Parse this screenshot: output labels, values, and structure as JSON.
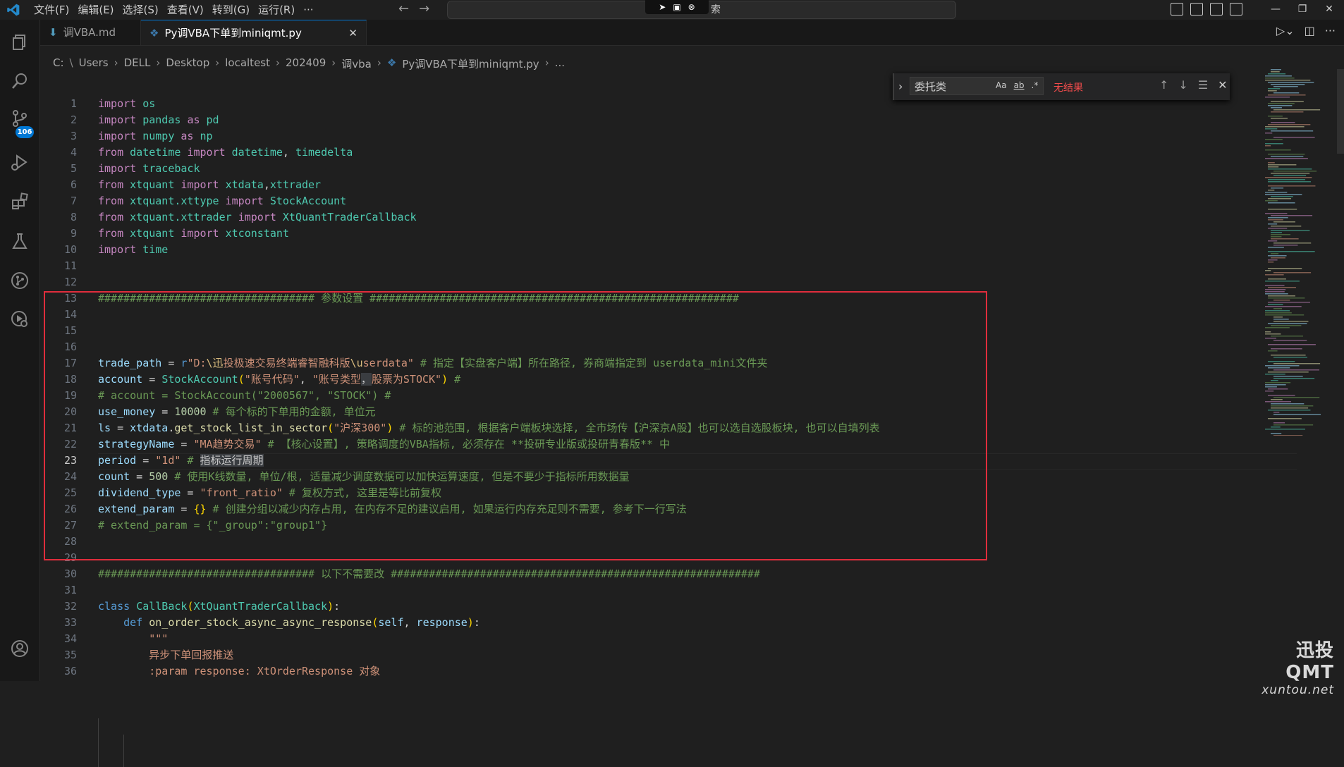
{
  "menu": [
    "文件(F)",
    "编辑(E)",
    "选择(S)",
    "查看(V)",
    "转到(G)",
    "运行(R)",
    "···"
  ],
  "command_center": {
    "text": "索"
  },
  "source_control_badge": "106",
  "tabs": [
    {
      "label": "调VBA.md",
      "icon": "markdown-icon",
      "active": false
    },
    {
      "label": "Py调VBA下单到miniqmt.py",
      "icon": "python-icon",
      "active": true
    }
  ],
  "breadcrumb": [
    "C:",
    "Users",
    "DELL",
    "Desktop",
    "localtest",
    "202409",
    "调vba",
    "Py调VBA下单到miniqmt.py",
    "..."
  ],
  "find": {
    "value": "委托类",
    "options": [
      "Aa",
      "ab",
      ".*"
    ],
    "result": "无结果"
  },
  "current_line": 23,
  "code": [
    [
      [
        "kw",
        "import"
      ],
      [
        "txt",
        " "
      ],
      [
        "cls",
        "os"
      ]
    ],
    [
      [
        "kw",
        "import"
      ],
      [
        "txt",
        " "
      ],
      [
        "cls",
        "pandas"
      ],
      [
        "txt",
        " "
      ],
      [
        "kw",
        "as"
      ],
      [
        "txt",
        " "
      ],
      [
        "cls",
        "pd"
      ]
    ],
    [
      [
        "kw",
        "import"
      ],
      [
        "txt",
        " "
      ],
      [
        "cls",
        "numpy"
      ],
      [
        "txt",
        " "
      ],
      [
        "kw",
        "as"
      ],
      [
        "txt",
        " "
      ],
      [
        "cls",
        "np"
      ]
    ],
    [
      [
        "kw",
        "from"
      ],
      [
        "txt",
        " "
      ],
      [
        "cls",
        "datetime"
      ],
      [
        "txt",
        " "
      ],
      [
        "kw",
        "import"
      ],
      [
        "txt",
        " "
      ],
      [
        "cls",
        "datetime"
      ],
      [
        "txt",
        ", "
      ],
      [
        "cls",
        "timedelta"
      ]
    ],
    [
      [
        "kw",
        "import"
      ],
      [
        "txt",
        " "
      ],
      [
        "cls",
        "traceback"
      ]
    ],
    [
      [
        "kw",
        "from"
      ],
      [
        "txt",
        " "
      ],
      [
        "cls",
        "xtquant"
      ],
      [
        "txt",
        " "
      ],
      [
        "kw",
        "import"
      ],
      [
        "txt",
        " "
      ],
      [
        "cls",
        "xtdata"
      ],
      [
        "txt",
        ","
      ],
      [
        "cls",
        "xttrader"
      ]
    ],
    [
      [
        "kw",
        "from"
      ],
      [
        "txt",
        " "
      ],
      [
        "cls",
        "xtquant.xttype"
      ],
      [
        "txt",
        " "
      ],
      [
        "kw",
        "import"
      ],
      [
        "txt",
        " "
      ],
      [
        "cls",
        "StockAccount"
      ]
    ],
    [
      [
        "kw",
        "from"
      ],
      [
        "txt",
        " "
      ],
      [
        "cls",
        "xtquant.xttrader"
      ],
      [
        "txt",
        " "
      ],
      [
        "kw",
        "import"
      ],
      [
        "txt",
        " "
      ],
      [
        "cls",
        "XtQuantTraderCallback"
      ]
    ],
    [
      [
        "kw",
        "from"
      ],
      [
        "txt",
        " "
      ],
      [
        "cls",
        "xtquant"
      ],
      [
        "txt",
        " "
      ],
      [
        "kw",
        "import"
      ],
      [
        "txt",
        " "
      ],
      [
        "cls",
        "xtconstant"
      ]
    ],
    [
      [
        "kw",
        "import"
      ],
      [
        "txt",
        " "
      ],
      [
        "cls",
        "time"
      ]
    ],
    [],
    [],
    [
      [
        "com",
        "################################## 参数设置 ##########################################################"
      ]
    ],
    [],
    [],
    [],
    [
      [
        "var",
        "trade_path"
      ],
      [
        "op",
        " = "
      ],
      [
        "def",
        "r"
      ],
      [
        "str",
        "\"D:"
      ],
      [
        "esc",
        "\\迅"
      ],
      [
        "str",
        "投极速交易终端睿智融科版"
      ],
      [
        "esc",
        "\\u"
      ],
      [
        "str",
        "serdata\""
      ],
      [
        "com",
        " # 指定【实盘客户端】所在路径, 券商端指定到 userdata_mini文件夹"
      ]
    ],
    [
      [
        "var",
        "account"
      ],
      [
        "op",
        " = "
      ],
      [
        "cls",
        "StockAccount"
      ],
      [
        "br",
        "("
      ],
      [
        "str",
        "\"账号代码\""
      ],
      [
        "txt",
        ", "
      ],
      [
        "str",
        "\"账号类型"
      ],
      [
        "hl",
        "，"
      ],
      [
        "str",
        "股票为STOCK\""
      ],
      [
        "br",
        ")"
      ],
      [
        "com",
        " #"
      ]
    ],
    [
      [
        "com",
        "# account = StockAccount(\"2000567\", \"STOCK\") #"
      ]
    ],
    [
      [
        "var",
        "use_money"
      ],
      [
        "op",
        " = "
      ],
      [
        "num",
        "10000"
      ],
      [
        "com",
        " # 每个标的下单用的金额, 单位元"
      ]
    ],
    [
      [
        "var",
        "ls"
      ],
      [
        "op",
        " = "
      ],
      [
        "var",
        "xtdata"
      ],
      [
        "txt",
        "."
      ],
      [
        "fn",
        "get_stock_list_in_sector"
      ],
      [
        "br",
        "("
      ],
      [
        "str",
        "\"沪深300\""
      ],
      [
        "br",
        ")"
      ],
      [
        "com",
        " # 标的池范围, 根据客户端板块选择, 全市场传【沪深京A股】也可以选自选股板块, 也可以自填列表"
      ]
    ],
    [
      [
        "var",
        "strategyName"
      ],
      [
        "op",
        " = "
      ],
      [
        "str",
        "\"MA趋势交易\""
      ],
      [
        "com",
        " # 【核心设置】, 策略调度的VBA指标, 必须存在 **投研专业版或投研青春版** 中"
      ]
    ],
    [
      [
        "var",
        "period"
      ],
      [
        "op",
        " = "
      ],
      [
        "str",
        "\"1d\""
      ],
      [
        "com",
        " # "
      ],
      [
        "hl",
        "指标运行周期"
      ]
    ],
    [
      [
        "var",
        "count"
      ],
      [
        "op",
        " = "
      ],
      [
        "num",
        "500"
      ],
      [
        "com",
        " # 使用K线数量, 单位/根, 适量减少调度数据可以加快运算速度, 但是不要少于指标所用数据量"
      ]
    ],
    [
      [
        "var",
        "dividend_type"
      ],
      [
        "op",
        " = "
      ],
      [
        "str",
        "\"front_ratio\""
      ],
      [
        "com",
        " # 复权方式, 这里是等比前复权"
      ]
    ],
    [
      [
        "var",
        "extend_param"
      ],
      [
        "op",
        " = "
      ],
      [
        "br",
        "{}"
      ],
      [
        "com",
        " # 创建分组以减少内存占用, 在内存不足的建议启用, 如果运行内存充足则不需要, 参考下一行写法"
      ]
    ],
    [
      [
        "com",
        "# extend_param = {\"_group\":\"group1\"}"
      ]
    ],
    [],
    [],
    [
      [
        "com",
        "################################## 以下不需要改 ##########################################################"
      ]
    ],
    [],
    [
      [
        "def",
        "class"
      ],
      [
        "txt",
        " "
      ],
      [
        "cls",
        "CallBack"
      ],
      [
        "br",
        "("
      ],
      [
        "cls",
        "XtQuantTraderCallback"
      ],
      [
        "br",
        ")"
      ],
      [
        "txt",
        ":"
      ]
    ],
    [
      [
        "txt",
        "    "
      ],
      [
        "def",
        "def"
      ],
      [
        "txt",
        " "
      ],
      [
        "fn",
        "on_order_stock_async_async_response"
      ],
      [
        "br",
        "("
      ],
      [
        "var",
        "self"
      ],
      [
        "txt",
        ", "
      ],
      [
        "var",
        "response"
      ],
      [
        "br",
        ")"
      ],
      [
        "txt",
        ":"
      ]
    ],
    [
      [
        "txt",
        "        "
      ],
      [
        "str",
        "\"\"\""
      ]
    ],
    [
      [
        "txt",
        "        "
      ],
      [
        "str",
        "异步下单回报推送"
      ]
    ],
    [
      [
        "txt",
        "        "
      ],
      [
        "str",
        ":param response: XtOrderResponse 对象"
      ]
    ]
  ],
  "watermark": {
    "line1": "迅投QMT",
    "line2": "xuntou.net"
  }
}
